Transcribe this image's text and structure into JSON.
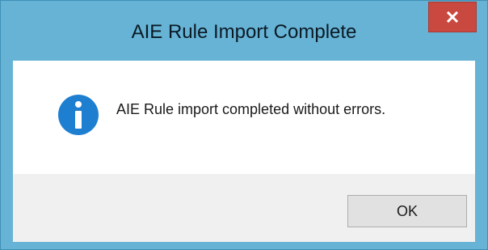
{
  "dialog": {
    "title": "AIE Rule Import Complete",
    "close_icon": "close-icon",
    "message_icon": "info-icon",
    "message": "AIE Rule import completed without errors.",
    "ok_label": "OK"
  },
  "colors": {
    "frame": "#66b3d6",
    "close_button": "#c9483f",
    "info_icon": "#1e7fd1",
    "button_bar": "#f0f0f0"
  }
}
